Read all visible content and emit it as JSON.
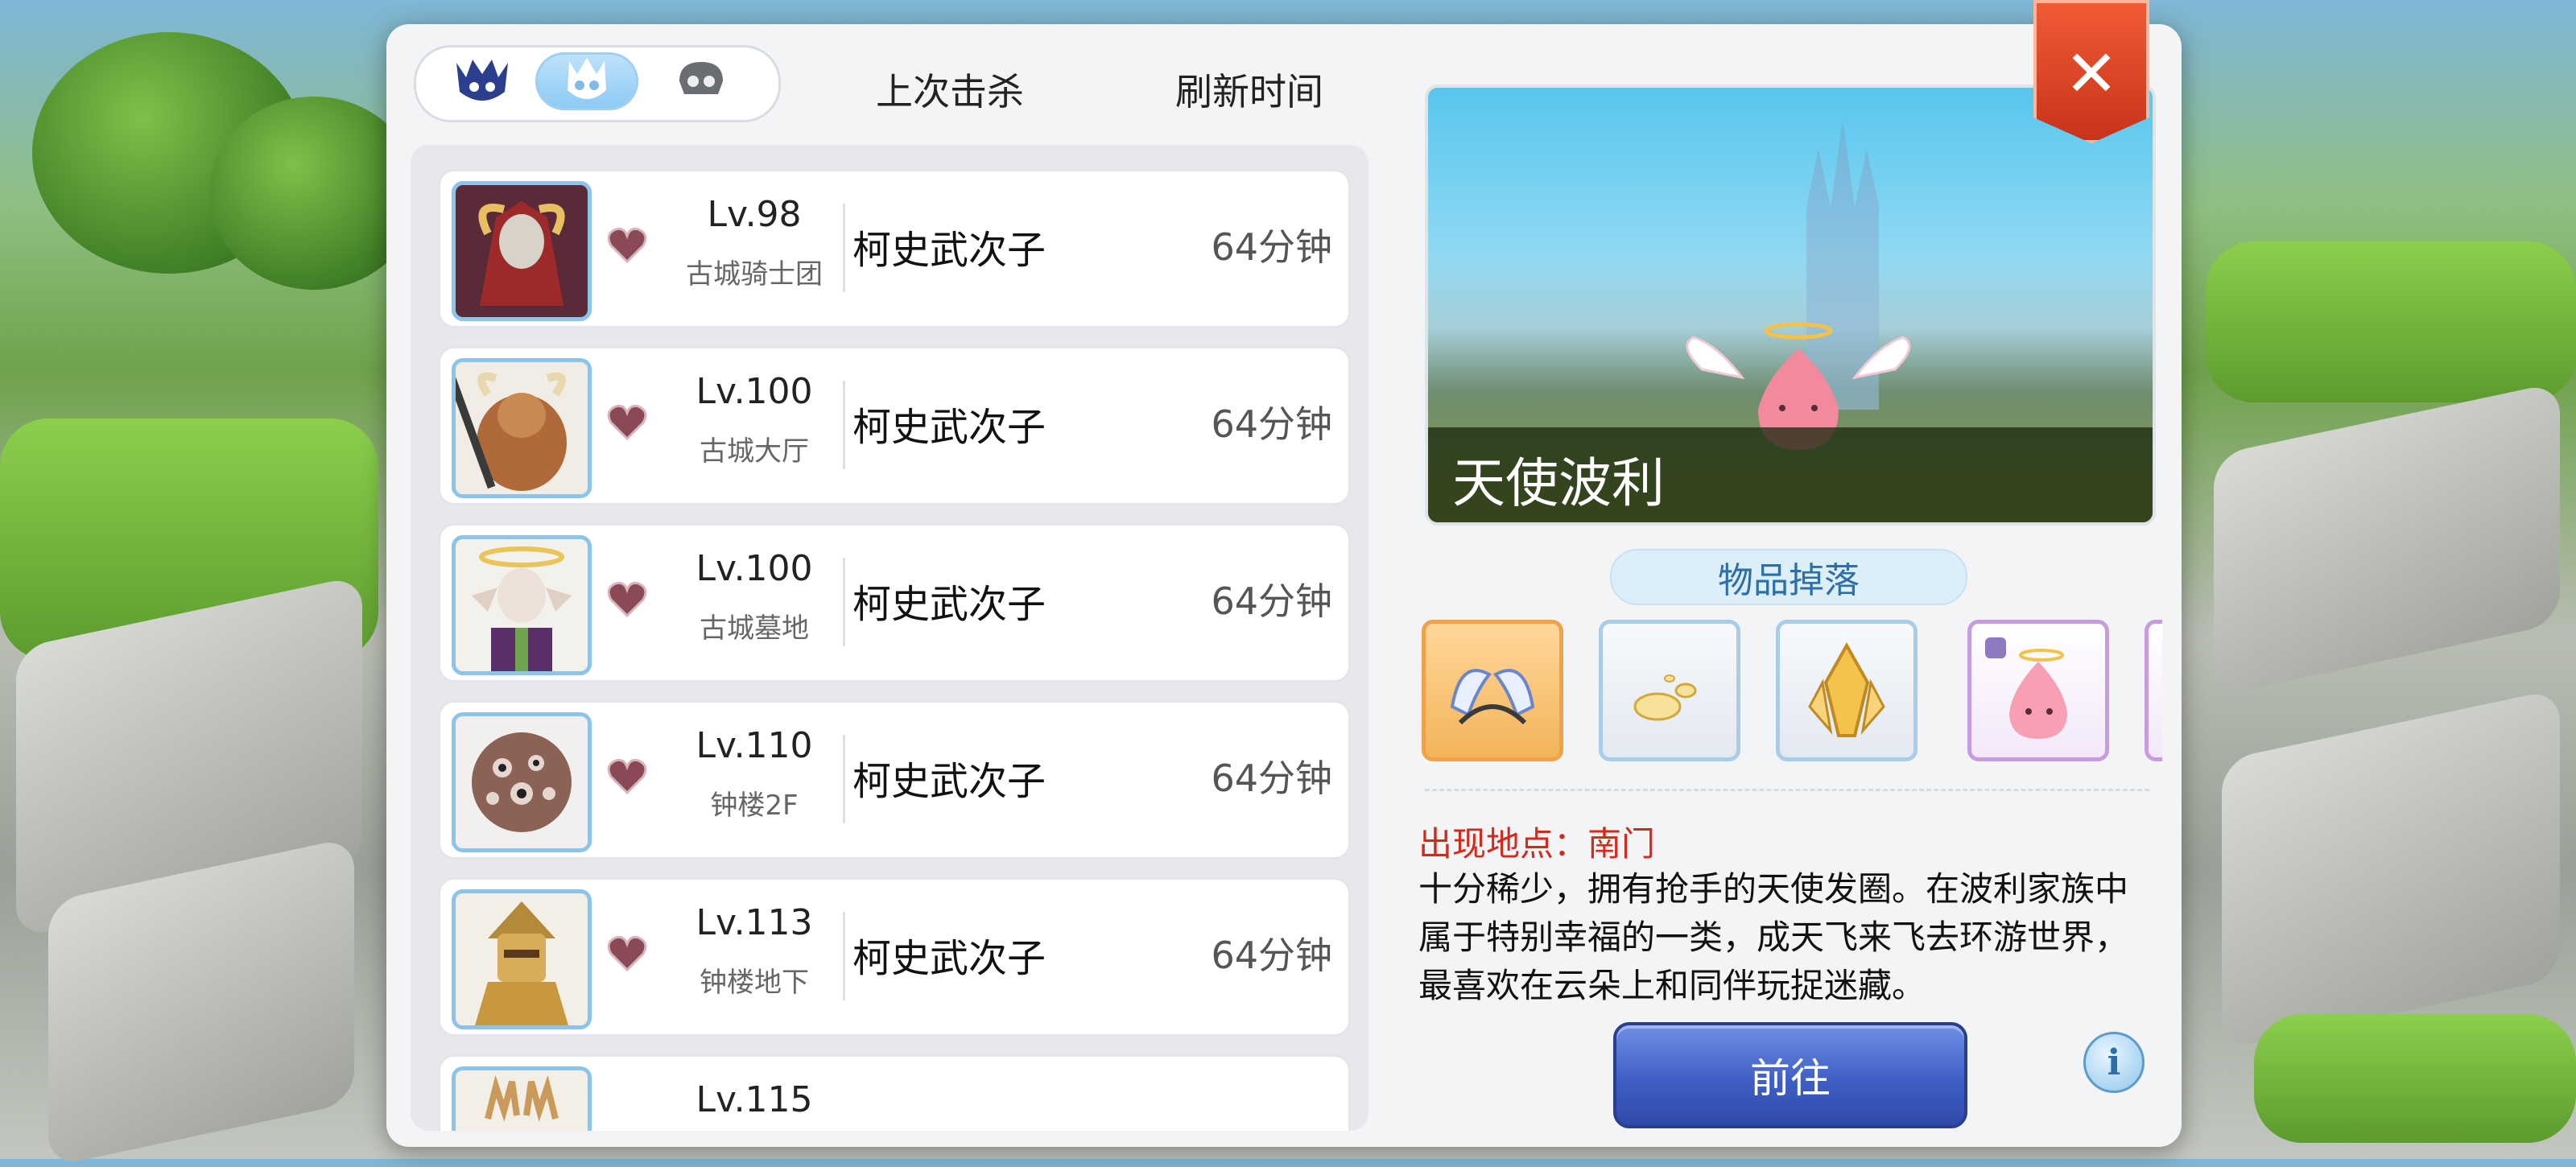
{
  "header": {
    "tabs": [
      {
        "icon": "dark-boss-skull-icon",
        "active": false
      },
      {
        "icon": "boss-skull-icon",
        "active": true
      },
      {
        "icon": "gray-skull-icon",
        "active": false
      }
    ],
    "last_kill_label": "上次击杀",
    "refresh_label": "刷新时间"
  },
  "boss_list": [
    {
      "level": "Lv.98",
      "map": "古城骑士团",
      "killer": "柯史武次子",
      "time": "64分钟",
      "portrait": "dark-knight-boss"
    },
    {
      "level": "Lv.100",
      "map": "古城大厅",
      "killer": "柯史武次子",
      "time": "64分钟",
      "portrait": "minotaur-boss"
    },
    {
      "level": "Lv.100",
      "map": "古城墓地",
      "killer": "柯史武次子",
      "time": "64分钟",
      "portrait": "skeleton-angel-boss"
    },
    {
      "level": "Lv.110",
      "map": "钟楼2F",
      "killer": "柯史武次子",
      "time": "64分钟",
      "portrait": "eyeball-boss"
    },
    {
      "level": "Lv.113",
      "map": "钟楼地下",
      "killer": "柯史武次子",
      "time": "64分钟",
      "portrait": "golden-warrior-boss"
    },
    {
      "level": "Lv.115",
      "map": "",
      "killer": "",
      "time": "",
      "portrait": "antler-boss"
    }
  ],
  "detail": {
    "monster_name": "天使波利",
    "drops_title": "物品掉落",
    "drops": [
      "angel-wing-headband",
      "jellopy-drops",
      "golden-crystal",
      "angeling-card",
      "hidden-item"
    ],
    "location": "出现地点：南门",
    "description": "十分稀少，拥有抢手的天使发圈。在波利家族中属于特别幸福的一类，成天飞来飞去环游世界，最喜欢在云朵上和同伴玩捉迷藏。",
    "go_label": "前往",
    "info_label": "i",
    "close_label": "✕"
  },
  "colors": {
    "accent_blue": "#3f5fc6",
    "location_red": "#d42a1c",
    "close_red": "#d8401f",
    "tab_active": "#8cc9f3"
  }
}
